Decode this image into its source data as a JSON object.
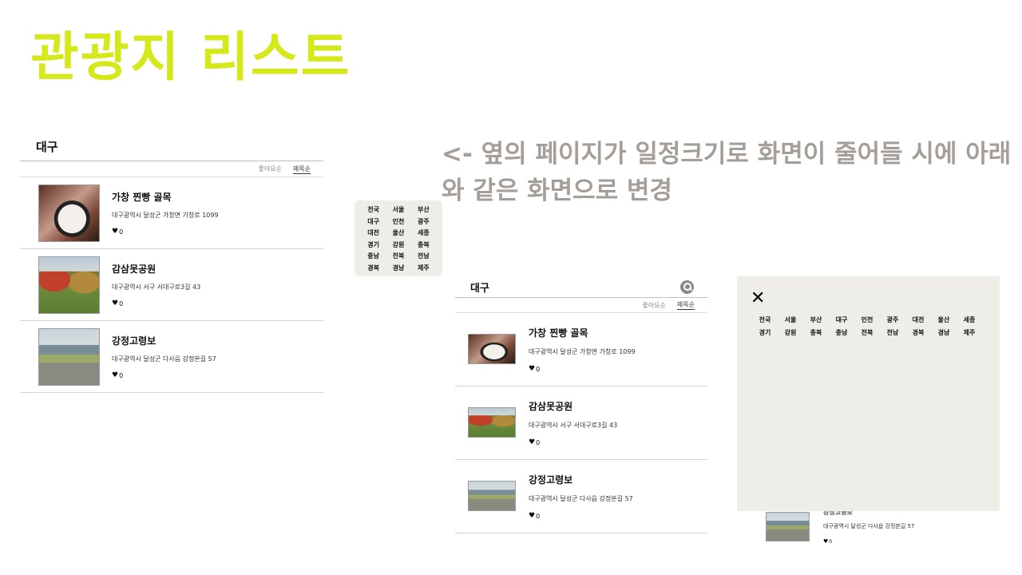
{
  "title": "관광지 리스트",
  "note": "<- 옆의 페이지가 일정크기로 화면이 줄어들 시에 아래와 같은 화면으로 변경",
  "region_title": "대구",
  "sort": {
    "likes": "좋아요순",
    "name": "제목순"
  },
  "regions": [
    "전국",
    "서울",
    "부산",
    "대구",
    "인천",
    "광주",
    "대전",
    "울산",
    "세종",
    "경기",
    "강원",
    "충북",
    "충남",
    "전북",
    "전남",
    "경북",
    "경남",
    "제주"
  ],
  "items": [
    {
      "name": "가창 찐빵 골목",
      "address": "대구광역시 달성군 가창면 가창로 1099",
      "likes": "0",
      "thumb": "food"
    },
    {
      "name": "감삼못공원",
      "address": "대구광역시 서구 서대구로3길 43",
      "likes": "0",
      "thumb": "park"
    },
    {
      "name": "강정고령보",
      "address": "대구광역시 달성군 다사읍 강정본길 57",
      "likes": "0",
      "thumb": "river"
    }
  ],
  "peek_item": {
    "name": "강정고령보",
    "address": "대구광역시 달성군 다사읍 강정본길 57",
    "likes": "0"
  },
  "icons": {
    "heart": "heart-icon",
    "search": "search-icon",
    "close": "close-icon"
  },
  "colors": {
    "title": "#d4e81a",
    "note": "#a59e98",
    "panel_bg": "#efede7"
  }
}
